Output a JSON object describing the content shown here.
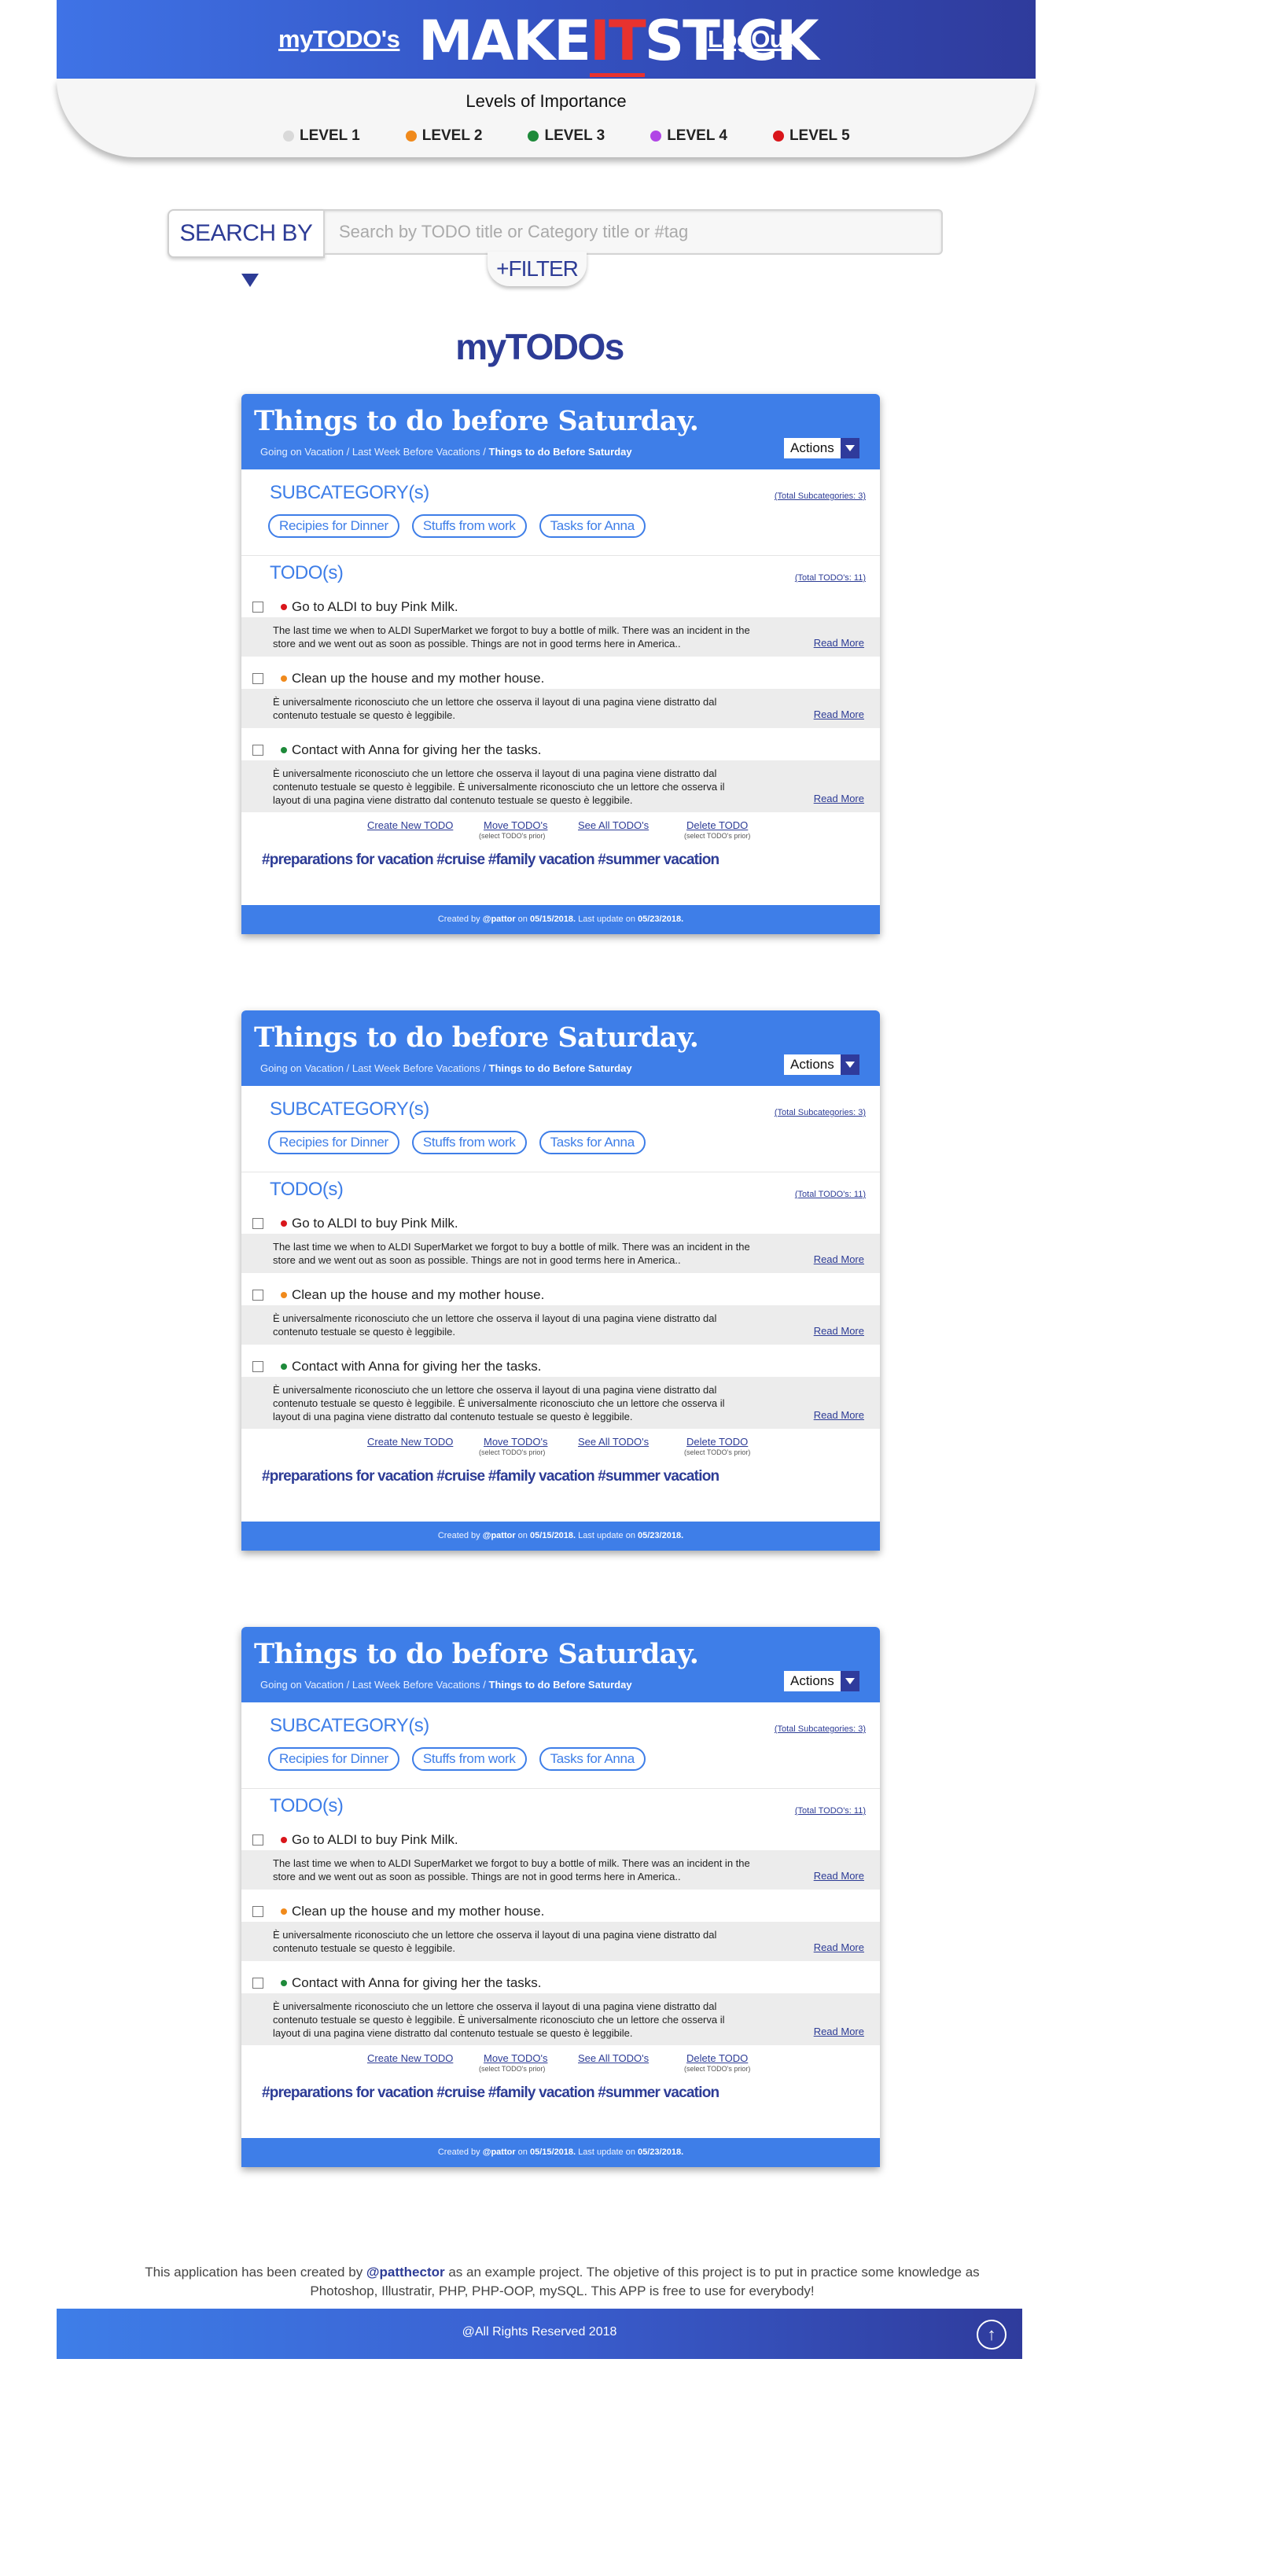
{
  "header": {
    "nav_mytodos": "myTODO's",
    "logo_pre": "MAKE",
    "logo_mid": "IT",
    "logo_post": "STICK",
    "nav_logout": "LogOut"
  },
  "levels": {
    "title": "Levels of Importance",
    "items": [
      {
        "label": "LEVEL 1",
        "color": "#d9d9d9"
      },
      {
        "label": "LEVEL 2",
        "color": "#f08a1c"
      },
      {
        "label": "LEVEL 3",
        "color": "#1e8a3a"
      },
      {
        "label": "LEVEL 4",
        "color": "#b146e6"
      },
      {
        "label": "LEVEL 5",
        "color": "#d9161b"
      }
    ]
  },
  "search": {
    "button_label": "SEARCH BY",
    "placeholder": "Search by TODO title or Category title or #tag",
    "filter_label": "+FILTER"
  },
  "main": {
    "title": "myTODOs"
  },
  "cards": [
    {
      "title": "Things to do before Saturday.",
      "crumb_1": "Going on Vacation",
      "crumb_sep": " / ",
      "crumb_2": "Last Week Before Vacations",
      "crumb_3": "Things to do Before Saturday",
      "actions_label": "Actions",
      "subcategory_heading": "SUBCATEGORY(s)",
      "subcategory_count": "(Total Subcategories: 3)",
      "subcategories": [
        "Recipies for Dinner",
        "Stuffs from work",
        "Tasks for Anna"
      ],
      "todo_heading": "TODO(s)",
      "todo_count": "(Total TODO's: 11)",
      "todos": [
        {
          "title": "Go to ALDI to buy Pink Milk.",
          "level_color": "#d9161b",
          "desc": "The last time we when to ALDI SuperMarket we forgot to buy a bottle of milk. There was an incident in the store and we went out as soon as possible. Things are not in good terms here in America..",
          "read_more": "Read More"
        },
        {
          "title": "Clean up the house and my mother house.",
          "level_color": "#f08a1c",
          "desc": "È universalmente riconosciuto che un lettore che osserva il layout di una pagina viene distratto dal contenuto testuale se questo è leggibile.",
          "read_more": "Read More"
        },
        {
          "title": "Contact with Anna for giving her the tasks.",
          "level_color": "#1e8a3a",
          "desc": "È universalmente riconosciuto che un lettore che osserva il layout di una pagina viene distratto dal contenuto testuale se questo è leggibile. È universalmente riconosciuto che un lettore che osserva il layout di una pagina viene distratto dal contenuto testuale se questo è leggibile.",
          "read_more": "Read More"
        }
      ],
      "links": {
        "create": "Create New TODO",
        "move": "Move TODO's",
        "move_sub": "(select TODO's prior)",
        "see_all": "See All TODO's",
        "delete": "Delete TODO",
        "delete_sub": "(select TODO's prior)"
      },
      "tags": "#preparations for vacation #cruise #family vacation #summer vacation",
      "footer": {
        "created_by": "Created by ",
        "author": "@pattor",
        "on": " on ",
        "created_date": "05/15/2018.",
        "last_update": " Last update on ",
        "updated_date": "05/23/2018."
      }
    },
    {
      "title": "Things to do before Saturday.",
      "crumb_1": "Going on Vacation",
      "crumb_sep": " / ",
      "crumb_2": "Last Week Before Vacations",
      "crumb_3": "Things to do Before Saturday",
      "actions_label": "Actions",
      "subcategory_heading": "SUBCATEGORY(s)",
      "subcategory_count": "(Total Subcategories: 3)",
      "subcategories": [
        "Recipies for Dinner",
        "Stuffs from work",
        "Tasks for Anna"
      ],
      "todo_heading": "TODO(s)",
      "todo_count": "(Total TODO's: 11)",
      "todos": [
        {
          "title": "Go to ALDI to buy Pink Milk.",
          "level_color": "#d9161b",
          "desc": "The last time we when to ALDI SuperMarket we forgot to buy a bottle of milk. There was an incident in the store and we went out as soon as possible. Things are not in good terms here in America..",
          "read_more": "Read More"
        },
        {
          "title": "Clean up the house and my mother house.",
          "level_color": "#f08a1c",
          "desc": "È universalmente riconosciuto che un lettore che osserva il layout di una pagina viene distratto dal contenuto testuale se questo è leggibile.",
          "read_more": "Read More"
        },
        {
          "title": "Contact with Anna for giving her the tasks.",
          "level_color": "#1e8a3a",
          "desc": "È universalmente riconosciuto che un lettore che osserva il layout di una pagina viene distratto dal contenuto testuale se questo è leggibile. È universalmente riconosciuto che un lettore che osserva il layout di una pagina viene distratto dal contenuto testuale se questo è leggibile.",
          "read_more": "Read More"
        }
      ],
      "links": {
        "create": "Create New TODO",
        "move": "Move TODO's",
        "move_sub": "(select TODO's prior)",
        "see_all": "See All TODO's",
        "delete": "Delete TODO",
        "delete_sub": "(select TODO's prior)"
      },
      "tags": "#preparations for vacation #cruise #family vacation #summer vacation",
      "footer": {
        "created_by": "Created by ",
        "author": "@pattor",
        "on": " on ",
        "created_date": "05/15/2018.",
        "last_update": " Last update on ",
        "updated_date": "05/23/2018."
      }
    },
    {
      "title": "Things to do before Saturday.",
      "crumb_1": "Going on Vacation",
      "crumb_sep": " / ",
      "crumb_2": "Last Week Before Vacations",
      "crumb_3": "Things to do Before Saturday",
      "actions_label": "Actions",
      "subcategory_heading": "SUBCATEGORY(s)",
      "subcategory_count": "(Total Subcategories: 3)",
      "subcategories": [
        "Recipies for Dinner",
        "Stuffs from work",
        "Tasks for Anna"
      ],
      "todo_heading": "TODO(s)",
      "todo_count": "(Total TODO's: 11)",
      "todos": [
        {
          "title": "Go to ALDI to buy Pink Milk.",
          "level_color": "#d9161b",
          "desc": "The last time we when to ALDI SuperMarket we forgot to buy a bottle of milk. There was an incident in the store and we went out as soon as possible. Things are not in good terms here in America..",
          "read_more": "Read More"
        },
        {
          "title": "Clean up the house and my mother house.",
          "level_color": "#f08a1c",
          "desc": "È universalmente riconosciuto che un lettore che osserva il layout di una pagina viene distratto dal contenuto testuale se questo è leggibile.",
          "read_more": "Read More"
        },
        {
          "title": "Contact with Anna for giving her the tasks.",
          "level_color": "#1e8a3a",
          "desc": "È universalmente riconosciuto che un lettore che osserva il layout di una pagina viene distratto dal contenuto testuale se questo è leggibile. È universalmente riconosciuto che un lettore che osserva il layout di una pagina viene distratto dal contenuto testuale se questo è leggibile.",
          "read_more": "Read More"
        }
      ],
      "links": {
        "create": "Create New TODO",
        "move": "Move TODO's",
        "move_sub": "(select TODO's prior)",
        "see_all": "See All TODO's",
        "delete": "Delete TODO",
        "delete_sub": "(select TODO's prior)"
      },
      "tags": "#preparations for vacation #cruise #family vacation #summer vacation",
      "footer": {
        "created_by": "Created by ",
        "author": "@pattor",
        "on": " on ",
        "created_date": "05/15/2018.",
        "last_update": " Last update on ",
        "updated_date": "05/23/2018."
      }
    }
  ],
  "about": {
    "text_1": "This application has been created by ",
    "author": "@patthector",
    "text_2": " as an example project. The objetive of this project is to put in practice some knowledge as Photoshop, Illustratir, PHP, PHP-OOP, mySQL. This APP is free to use for everybody!"
  },
  "footer": {
    "copyright": "@All Rights Reserved   2018",
    "up_icon": "arrow-up-icon"
  }
}
